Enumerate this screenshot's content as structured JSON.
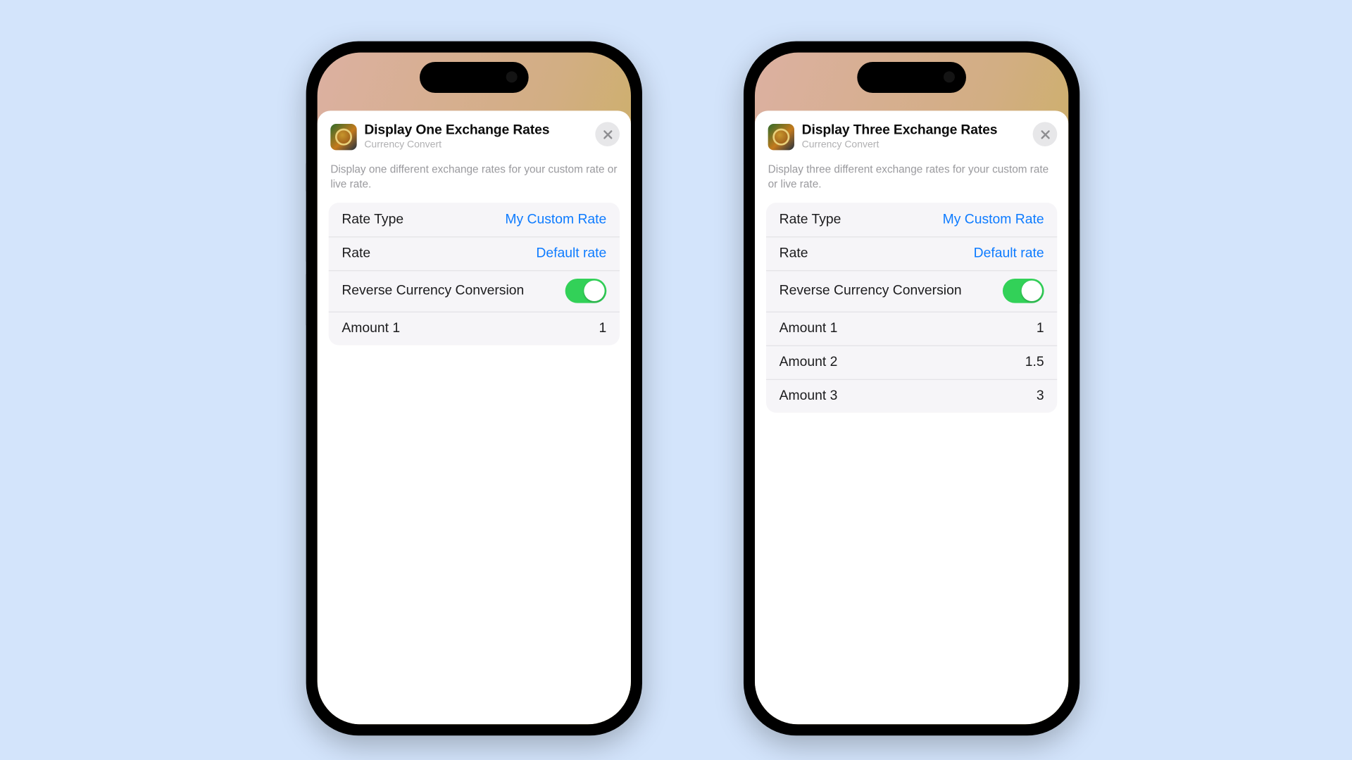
{
  "phones": {
    "left": {
      "title": "Display One Exchange Rates",
      "subtitle": "Currency Convert",
      "description": "Display one different exchange rates for your custom rate or live rate.",
      "rows": {
        "rateType": {
          "label": "Rate Type",
          "value": "My Custom Rate"
        },
        "rate": {
          "label": "Rate",
          "value": "Default rate"
        },
        "reverse": {
          "label": "Reverse Currency Conversion",
          "on": true
        },
        "amount1": {
          "label": "Amount 1",
          "value": "1"
        }
      }
    },
    "right": {
      "title": "Display Three Exchange Rates",
      "subtitle": "Currency Convert",
      "description": "Display three different exchange rates for your custom rate or live rate.",
      "rows": {
        "rateType": {
          "label": "Rate Type",
          "value": "My Custom Rate"
        },
        "rate": {
          "label": "Rate",
          "value": "Default rate"
        },
        "reverse": {
          "label": "Reverse Currency Conversion",
          "on": true
        },
        "amount1": {
          "label": "Amount 1",
          "value": "1"
        },
        "amount2": {
          "label": "Amount 2",
          "value": "1.5"
        },
        "amount3": {
          "label": "Amount 3",
          "value": "3"
        }
      }
    }
  }
}
